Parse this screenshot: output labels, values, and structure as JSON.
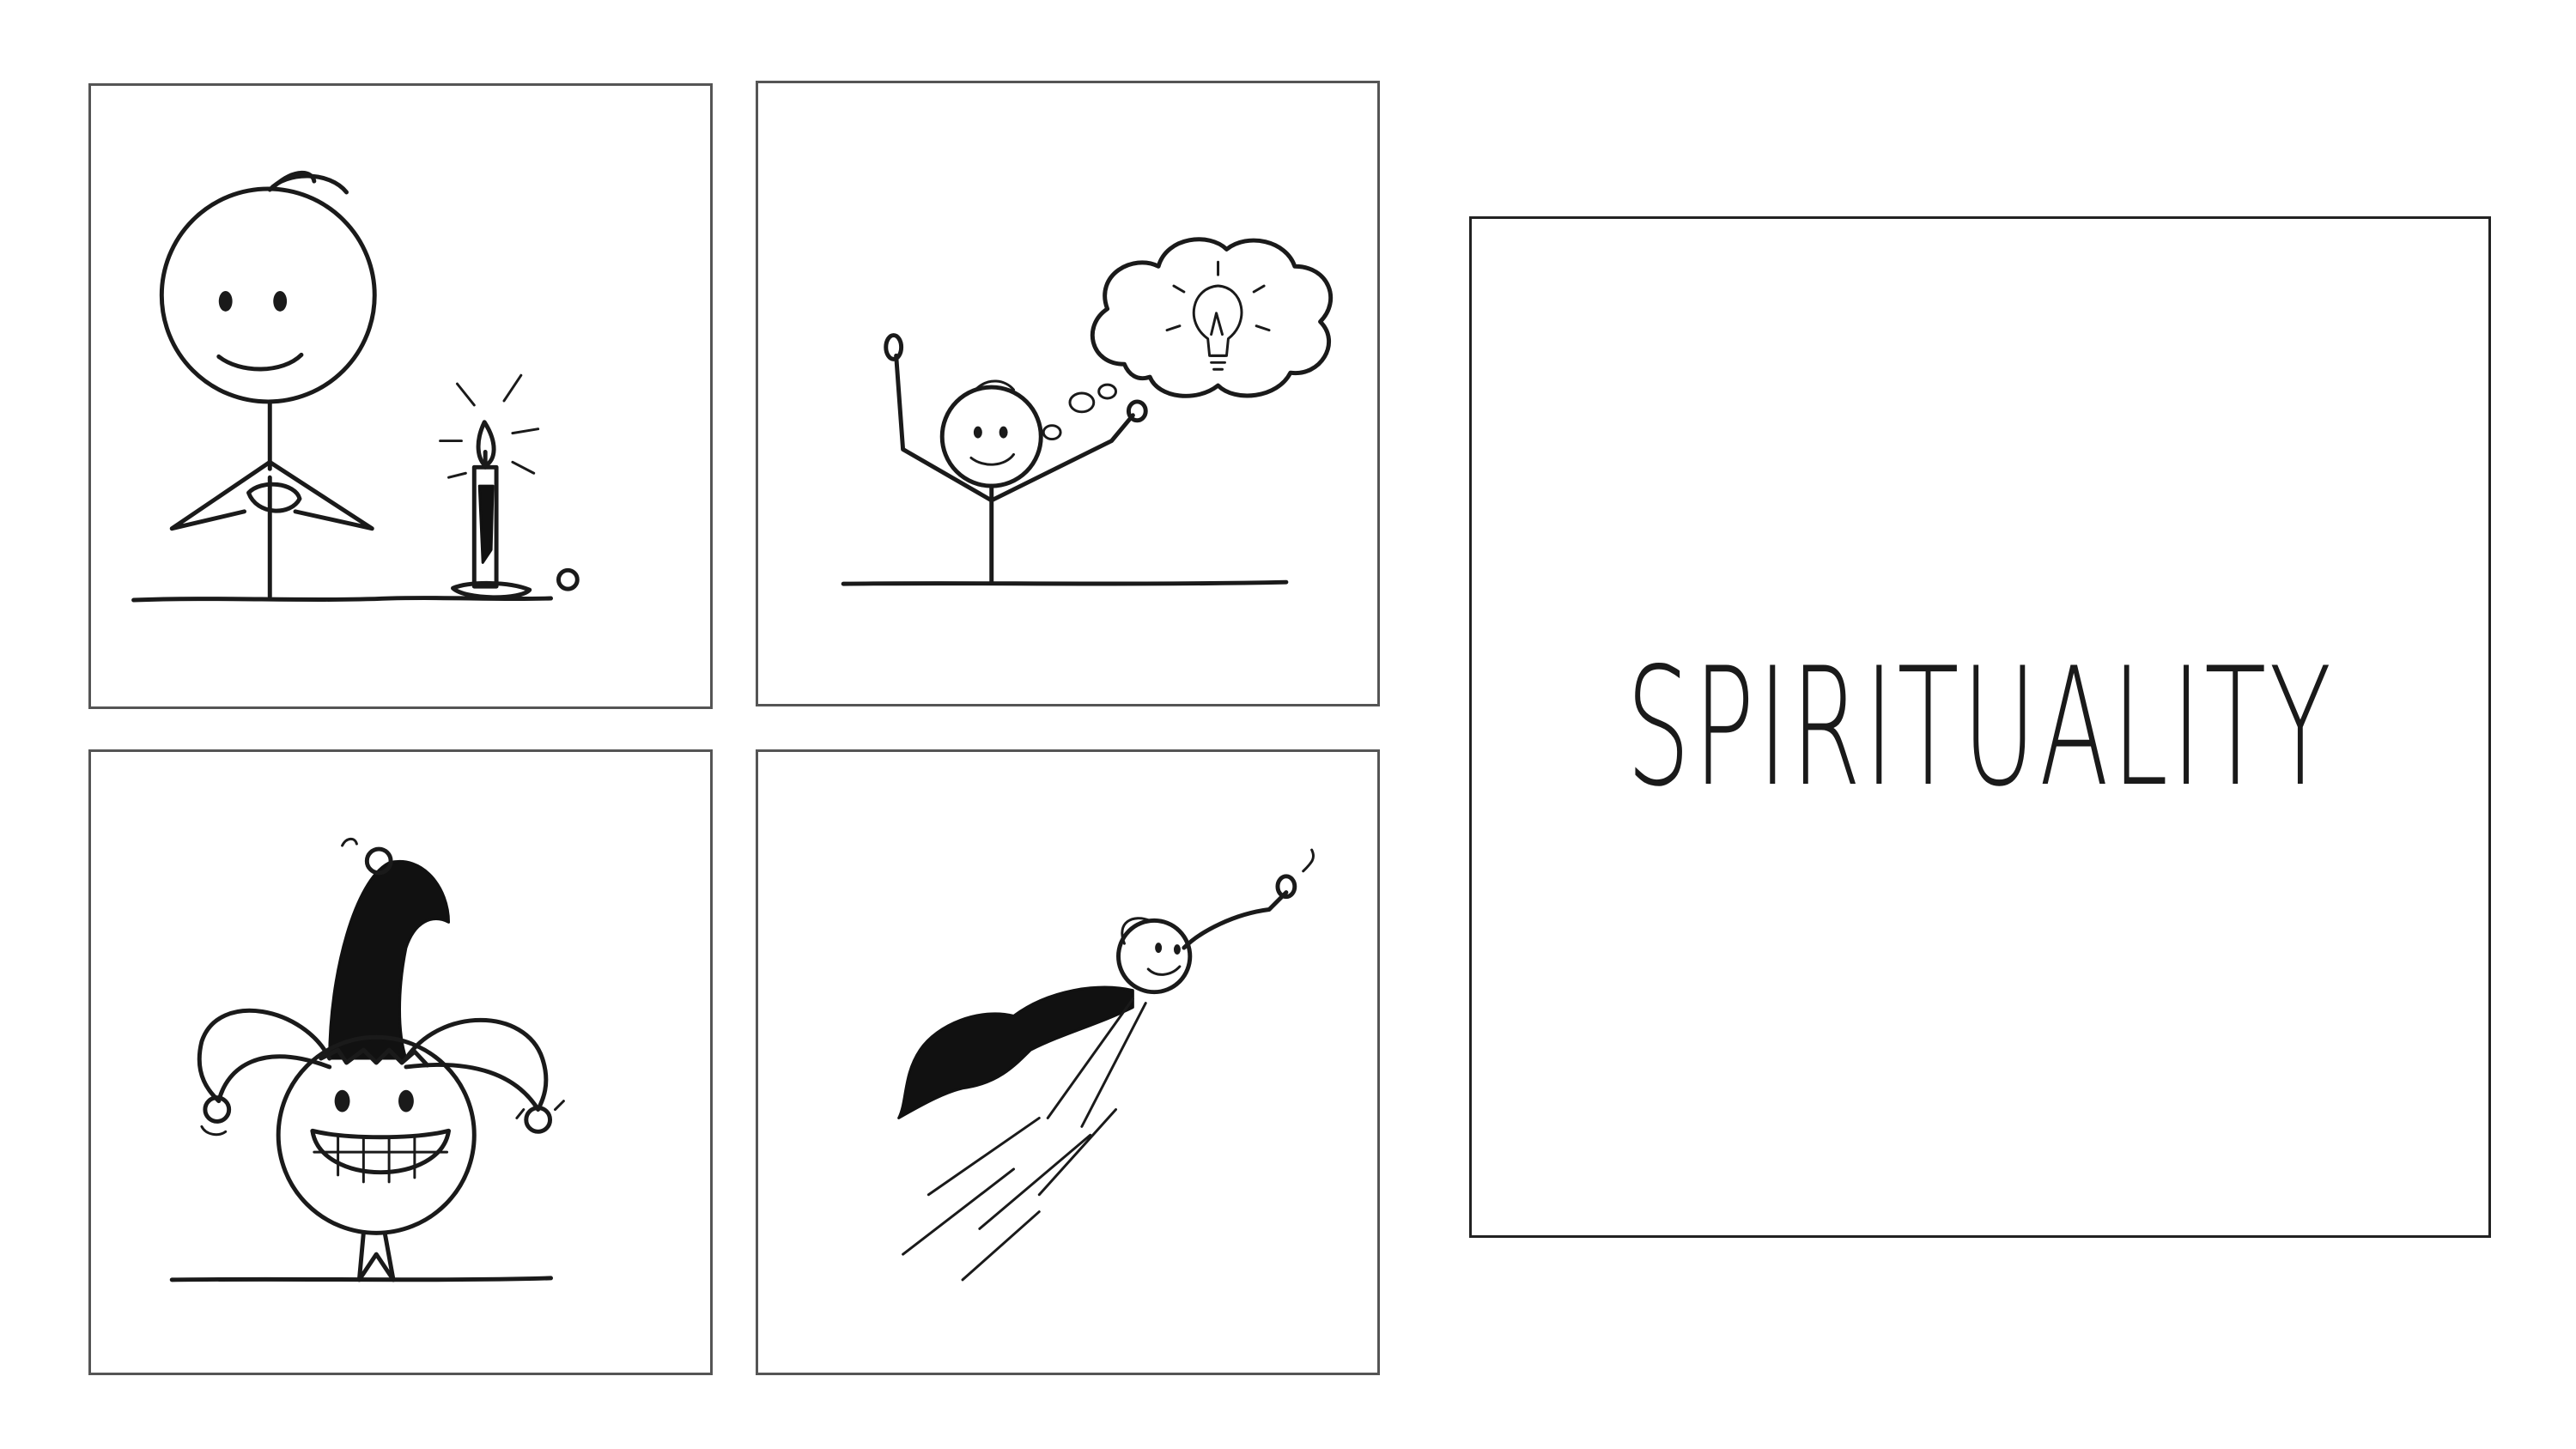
{
  "slide": {
    "title": "SPIRITUALITY"
  },
  "panels": [
    {
      "icon": "stick-figure-with-candle-icon"
    },
    {
      "icon": "stick-figure-lightbulb-idea-icon"
    },
    {
      "icon": "stick-figure-jester-hat-icon"
    },
    {
      "icon": "stick-figure-superhero-flying-icon"
    }
  ],
  "colors": {
    "ink": "#1a1a1a",
    "background": "#ffffff",
    "panel_border": "#555555"
  }
}
